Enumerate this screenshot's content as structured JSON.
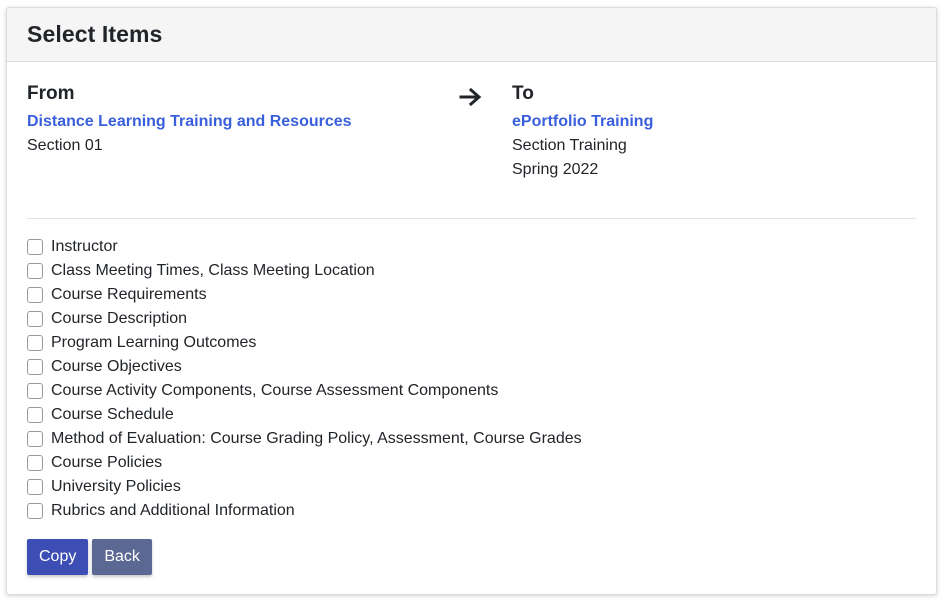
{
  "header": {
    "title": "Select Items"
  },
  "from": {
    "label": "From",
    "course_link": "Distance Learning Training and Resources",
    "section": "Section 01"
  },
  "to": {
    "label": "To",
    "course_link": "ePortfolio Training",
    "section": "Section Training",
    "term": "Spring 2022"
  },
  "items": [
    {
      "label": "Instructor",
      "checked": false
    },
    {
      "label": "Class Meeting Times, Class Meeting Location",
      "checked": false
    },
    {
      "label": "Course Requirements",
      "checked": false
    },
    {
      "label": "Course Description",
      "checked": false
    },
    {
      "label": "Program Learning Outcomes",
      "checked": false
    },
    {
      "label": "Course Objectives",
      "checked": false
    },
    {
      "label": "Course Activity Components, Course Assessment Components",
      "checked": false
    },
    {
      "label": "Course Schedule",
      "checked": false
    },
    {
      "label": "Method of Evaluation: Course Grading Policy, Assessment, Course Grades",
      "checked": false
    },
    {
      "label": "Course Policies",
      "checked": false
    },
    {
      "label": "University Policies",
      "checked": false
    },
    {
      "label": "Rubrics and Additional Information",
      "checked": false
    }
  ],
  "buttons": {
    "copy_label": "Copy",
    "back_label": "Back"
  },
  "colors": {
    "link": "#3a5fdc",
    "copy_button": "#3c4db4",
    "back_button": "#5b6893"
  },
  "icons": {
    "arrow": "arrow-right-icon"
  }
}
